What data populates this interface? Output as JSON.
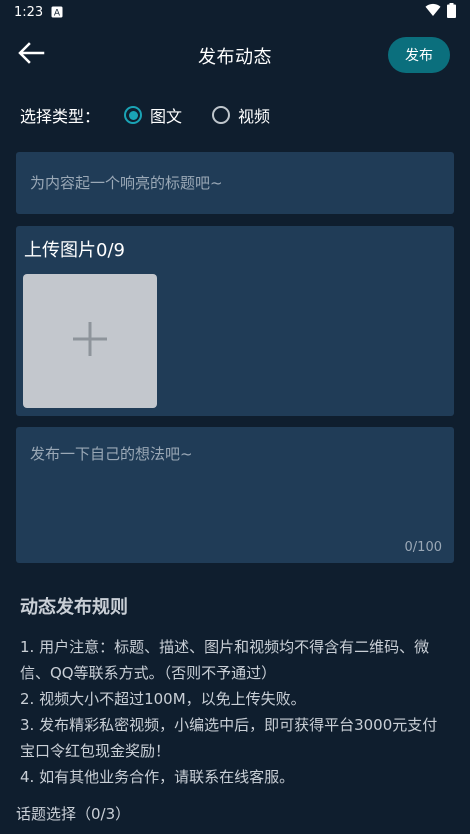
{
  "status_bar": {
    "time": "1:23",
    "notification_icon": "a-badge-icon",
    "wifi_icon": "wifi-icon",
    "battery_icon": "battery-icon"
  },
  "header": {
    "back_icon": "arrow-left-icon",
    "title": "发布动态",
    "publish_label": "发布"
  },
  "type_select": {
    "label": "选择类型：",
    "options": [
      {
        "label": "图文",
        "selected": true
      },
      {
        "label": "视频",
        "selected": false
      }
    ]
  },
  "title_input": {
    "placeholder": "为内容起一个响亮的标题吧~",
    "value": ""
  },
  "upload": {
    "title": "上传图片0/9",
    "add_icon": "plus-icon"
  },
  "content_input": {
    "placeholder": "发布一下自己的想法吧~",
    "value": "",
    "counter": "0/100"
  },
  "rules": {
    "title": "动态发布规则",
    "items": [
      "1. 用户注意：标题、描述、图片和视频均不得含有二维码、微信、QQ等联系方式。（否则不予通过）",
      "2. 视频大小不超过100M，以免上传失败。",
      "3. 发布精彩私密视频，小编选中后，即可获得平台3000元支付宝口令红包现金奖励！",
      "4. 如有其他业务合作，请联系在线客服。"
    ]
  },
  "topic": {
    "label": "话题选择（0/3）"
  },
  "colors": {
    "background": "#0f1e2e",
    "card": "#203c57",
    "accent": "#0b6f7d",
    "radio_checked": "#1aa3b5",
    "tile": "#c3c7cd"
  }
}
